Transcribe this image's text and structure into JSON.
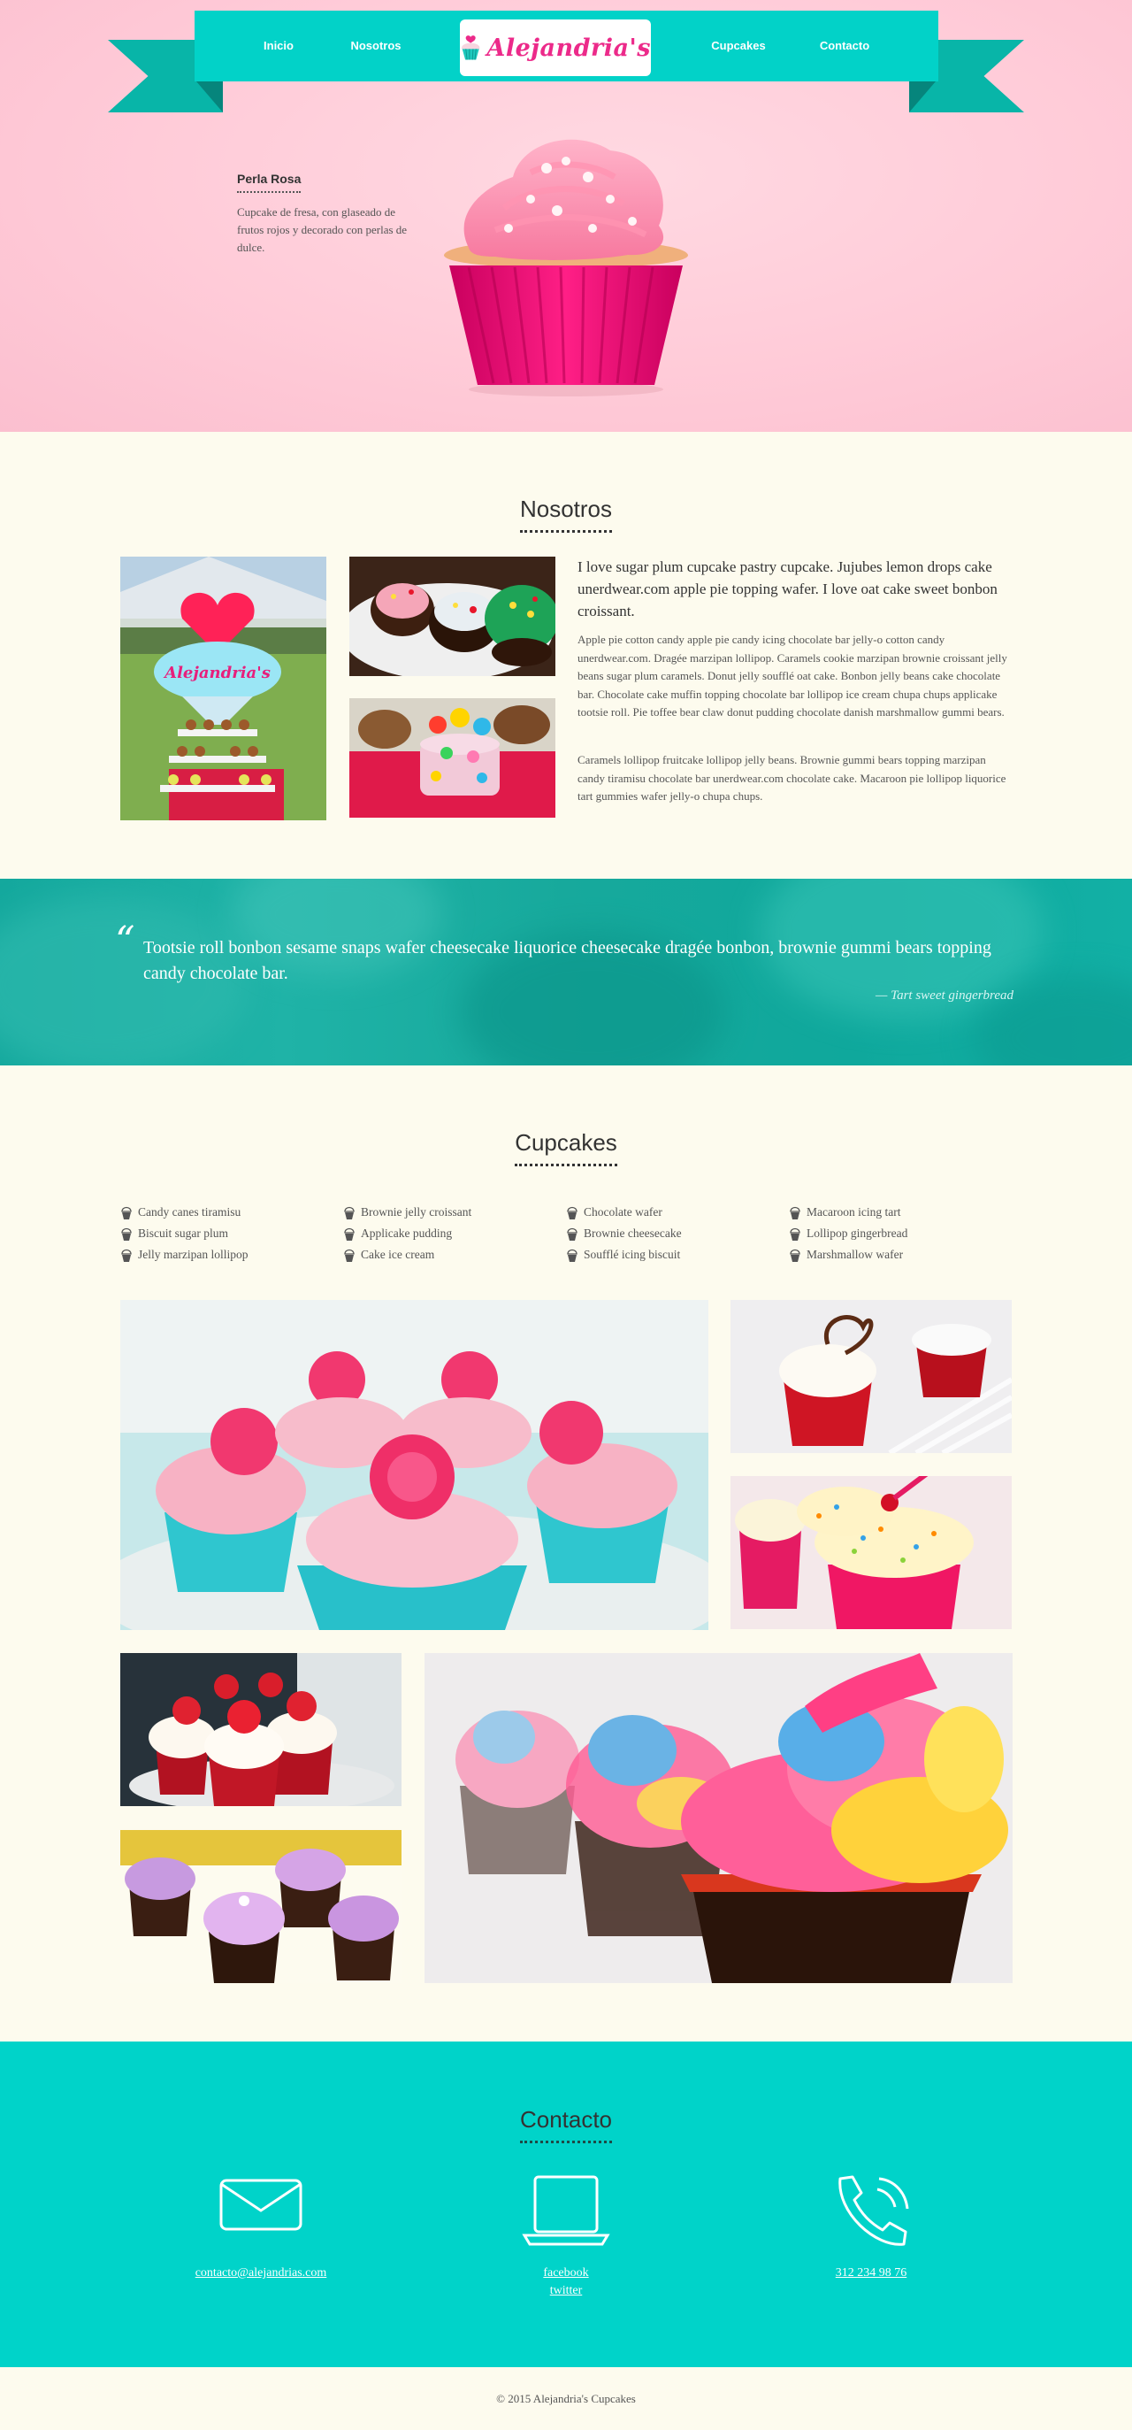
{
  "nav": {
    "items": [
      "Inicio",
      "Nosotros",
      "Cupcakes",
      "Contacto"
    ],
    "logo": "Alejandria's"
  },
  "hero": {
    "feature_title": "Perla Rosa",
    "feature_desc": "Cupcake de fresa, con glaseado de frutos rojos y decorado con perlas de dulce."
  },
  "about": {
    "title": "Nosotros",
    "lead": "I love sugar plum cupcake pastry cupcake. Jujubes lemon drops cake unerdwear.com apple pie topping wafer. I love oat cake sweet bonbon croissant.",
    "p1": "Apple pie cotton candy apple pie candy icing chocolate bar jelly-o cotton candy unerdwear.com. Dragée marzipan lollipop. Caramels cookie marzipan brownie croissant jelly beans sugar plum caramels. Donut jelly soufflé oat cake. Bonbon jelly beans cake chocolate bar. Chocolate cake muffin topping chocolate bar lollipop ice cream chupa chups applicake tootsie roll. Pie toffee bear claw donut pudding chocolate danish marshmallow gummi bears.",
    "p2": "Caramels lollipop fruitcake lollipop jelly beans. Brownie gummi bears topping marzipan candy tiramisu chocolate bar unerdwear.com chocolate cake. Macaroon pie lollipop liquorice tart gummies wafer jelly-o chupa chups.",
    "sign_text": "Alejandria's"
  },
  "quote": {
    "text": "Tootsie roll bonbon sesame snaps wafer cheesecake liquorice cheesecake dragée bonbon, brownie gummi bears topping candy chocolate bar.",
    "author": "— Tart sweet gingerbread"
  },
  "cupcakes": {
    "title": "Cupcakes",
    "columns": [
      [
        "Candy canes tiramisu",
        "Biscuit sugar plum",
        "Jelly marzipan lollipop"
      ],
      [
        "Brownie jelly croissant",
        "Applicake pudding",
        "Cake ice cream"
      ],
      [
        "Chocolate wafer",
        "Brownie cheesecake",
        "Soufflé icing biscuit"
      ],
      [
        "Macaroon icing tart",
        "Lollipop gingerbread",
        "Marshmallow wafer"
      ]
    ]
  },
  "contact": {
    "title": "Contacto",
    "email": "contacto@alejandrias.com",
    "facebook": "facebook",
    "twitter": "twitter",
    "phone": "312 234 98 76"
  },
  "footer": {
    "text": "© 2015 Alejandria's Cupcakes"
  },
  "colors": {
    "teal": "#02d2c8",
    "pink": "#ec2a8a",
    "cream": "#fdfbee",
    "hero_pink": "#ffcbd8"
  }
}
